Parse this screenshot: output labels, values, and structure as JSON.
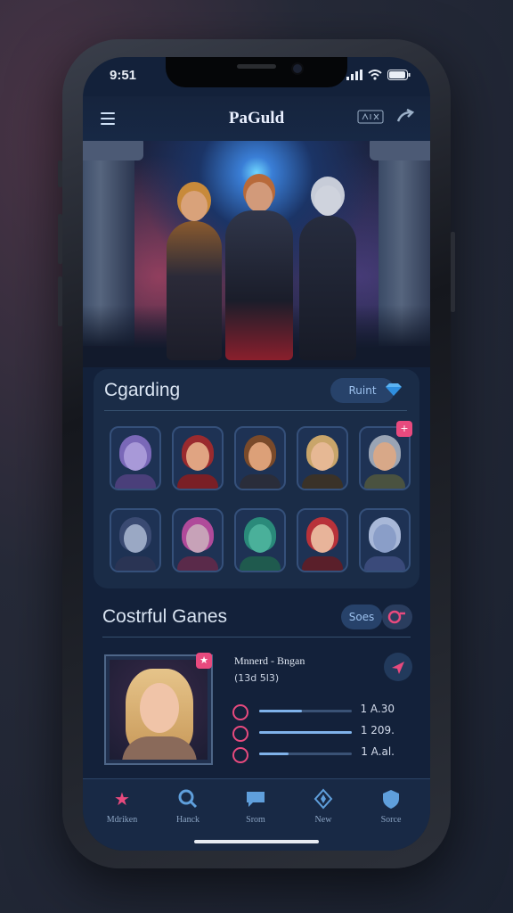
{
  "status": {
    "time": "9:51"
  },
  "header": {
    "title": "PaGuld",
    "right_icon_1": "badge-icon",
    "right_icon_2": "share-icon"
  },
  "hero": {
    "image": "three-warrior-heroes-artwork"
  },
  "section1": {
    "title": "Cgarding",
    "pill_label": "Ruint",
    "avatars_row1": [
      "purple-sorcerer",
      "red-hooded-warrior",
      "brown-haired-rogue",
      "blonde-elf-archer",
      "armored-knight"
    ],
    "avatars_row2": [
      "hooded-mage",
      "pink-horned-witch",
      "green-goblin",
      "red-haired-heroine",
      "silver-haired-spirit"
    ],
    "badge": "+"
  },
  "section2": {
    "title": "Costrful Ganes",
    "pill_label": "Soes",
    "feature_name": "Mnnerd - Bngan",
    "feature_sub": "(13d 5l3)",
    "stats": [
      {
        "value": "1 A.30",
        "fill": 0.46
      },
      {
        "value": "1 209.",
        "fill": 1.0
      },
      {
        "value": "1 A.al.",
        "fill": 0.32
      }
    ]
  },
  "tabs": [
    {
      "label": "Mdriken",
      "icon": "star-icon"
    },
    {
      "label": "Hanck",
      "icon": "search-icon"
    },
    {
      "label": "Srom",
      "icon": "chat-icon"
    },
    {
      "label": "New",
      "icon": "compass-icon"
    },
    {
      "label": "Sorce",
      "icon": "shield-icon"
    }
  ],
  "colors": {
    "accent": "#e84a7e",
    "blue": "#5f9fdc",
    "bg": "#13213a"
  }
}
